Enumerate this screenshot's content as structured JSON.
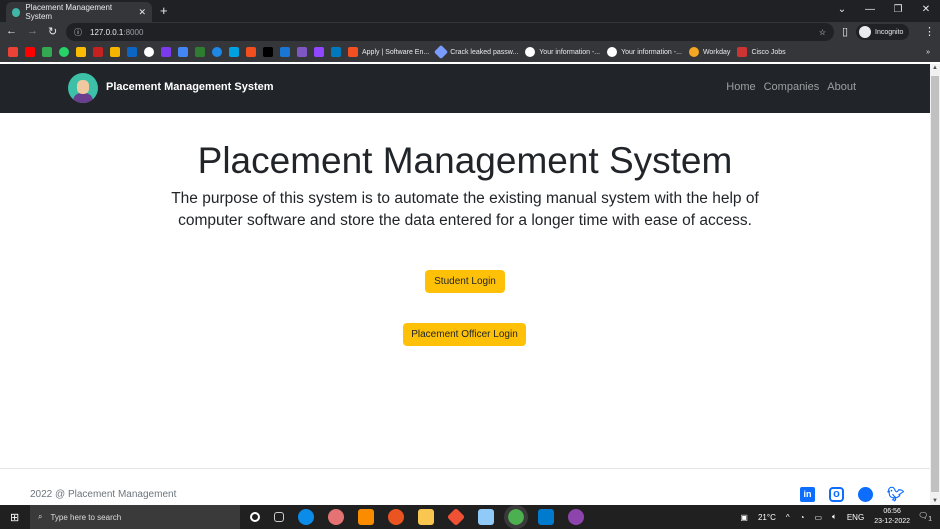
{
  "browser": {
    "tab_title": "Placement Management System",
    "url_host": "127.0.0.1",
    "url_port": ":8000",
    "incognito_label": "Incognito",
    "bookmarks": [
      "Apply | Software En...",
      "Crack leaked passw...",
      "Your information -...",
      "Your information -...",
      "Workday",
      "Cisco Jobs"
    ]
  },
  "navbar": {
    "brand": "Placement Management System",
    "links": [
      "Home",
      "Companies",
      "About"
    ]
  },
  "hero": {
    "title": "Placement Management System",
    "lead": "The purpose of this system is to automate the existing manual system with the help of computer software and store the data entered for a longer time with ease of access.",
    "student_login": "Student Login",
    "officer_login": "Placement Officer Login"
  },
  "footer": {
    "text": "2022 @ Placement Management",
    "social": [
      "linkedin",
      "instagram",
      "github",
      "twitter"
    ]
  },
  "taskbar": {
    "search_placeholder": "Type here to search",
    "temperature": "21°C",
    "language": "ENG",
    "time": "06:56",
    "date": "23-12-2022",
    "notifications": "1"
  },
  "colors": {
    "navbar": "#212529",
    "button": "#ffc107",
    "social": "#0d6efd"
  }
}
